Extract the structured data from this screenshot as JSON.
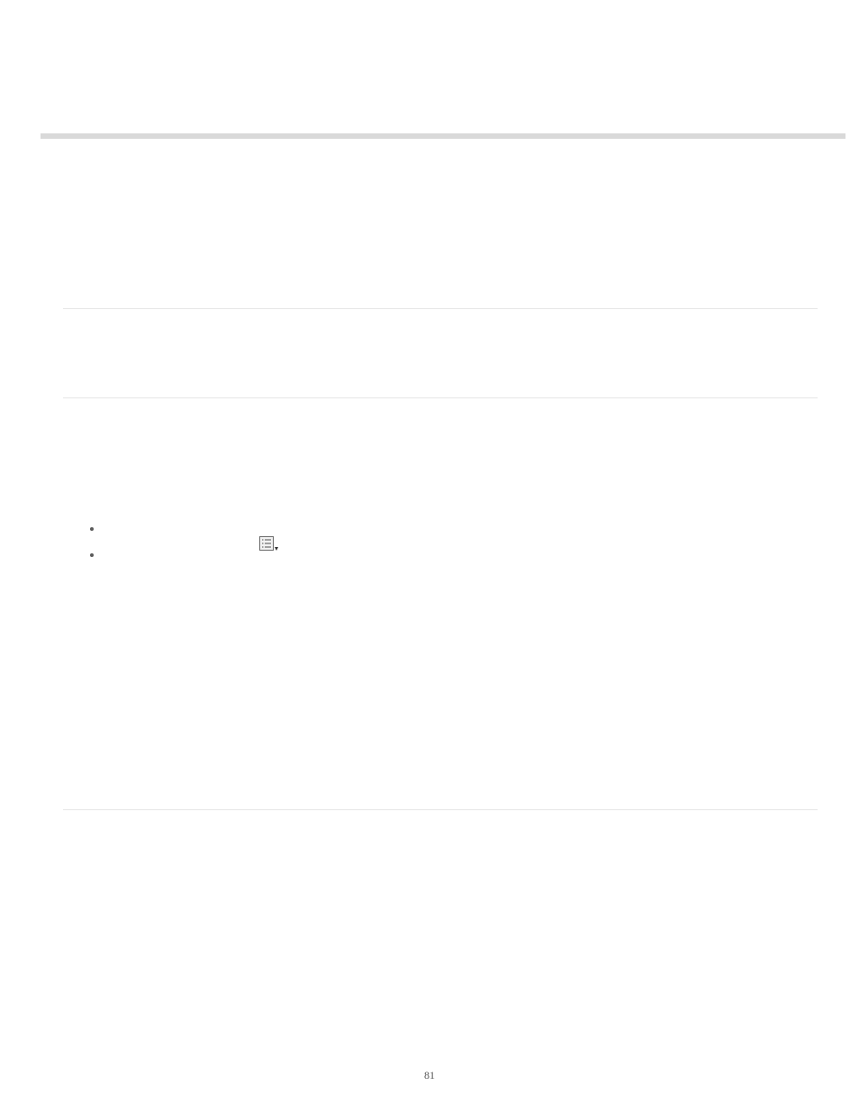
{
  "page_number": "81"
}
